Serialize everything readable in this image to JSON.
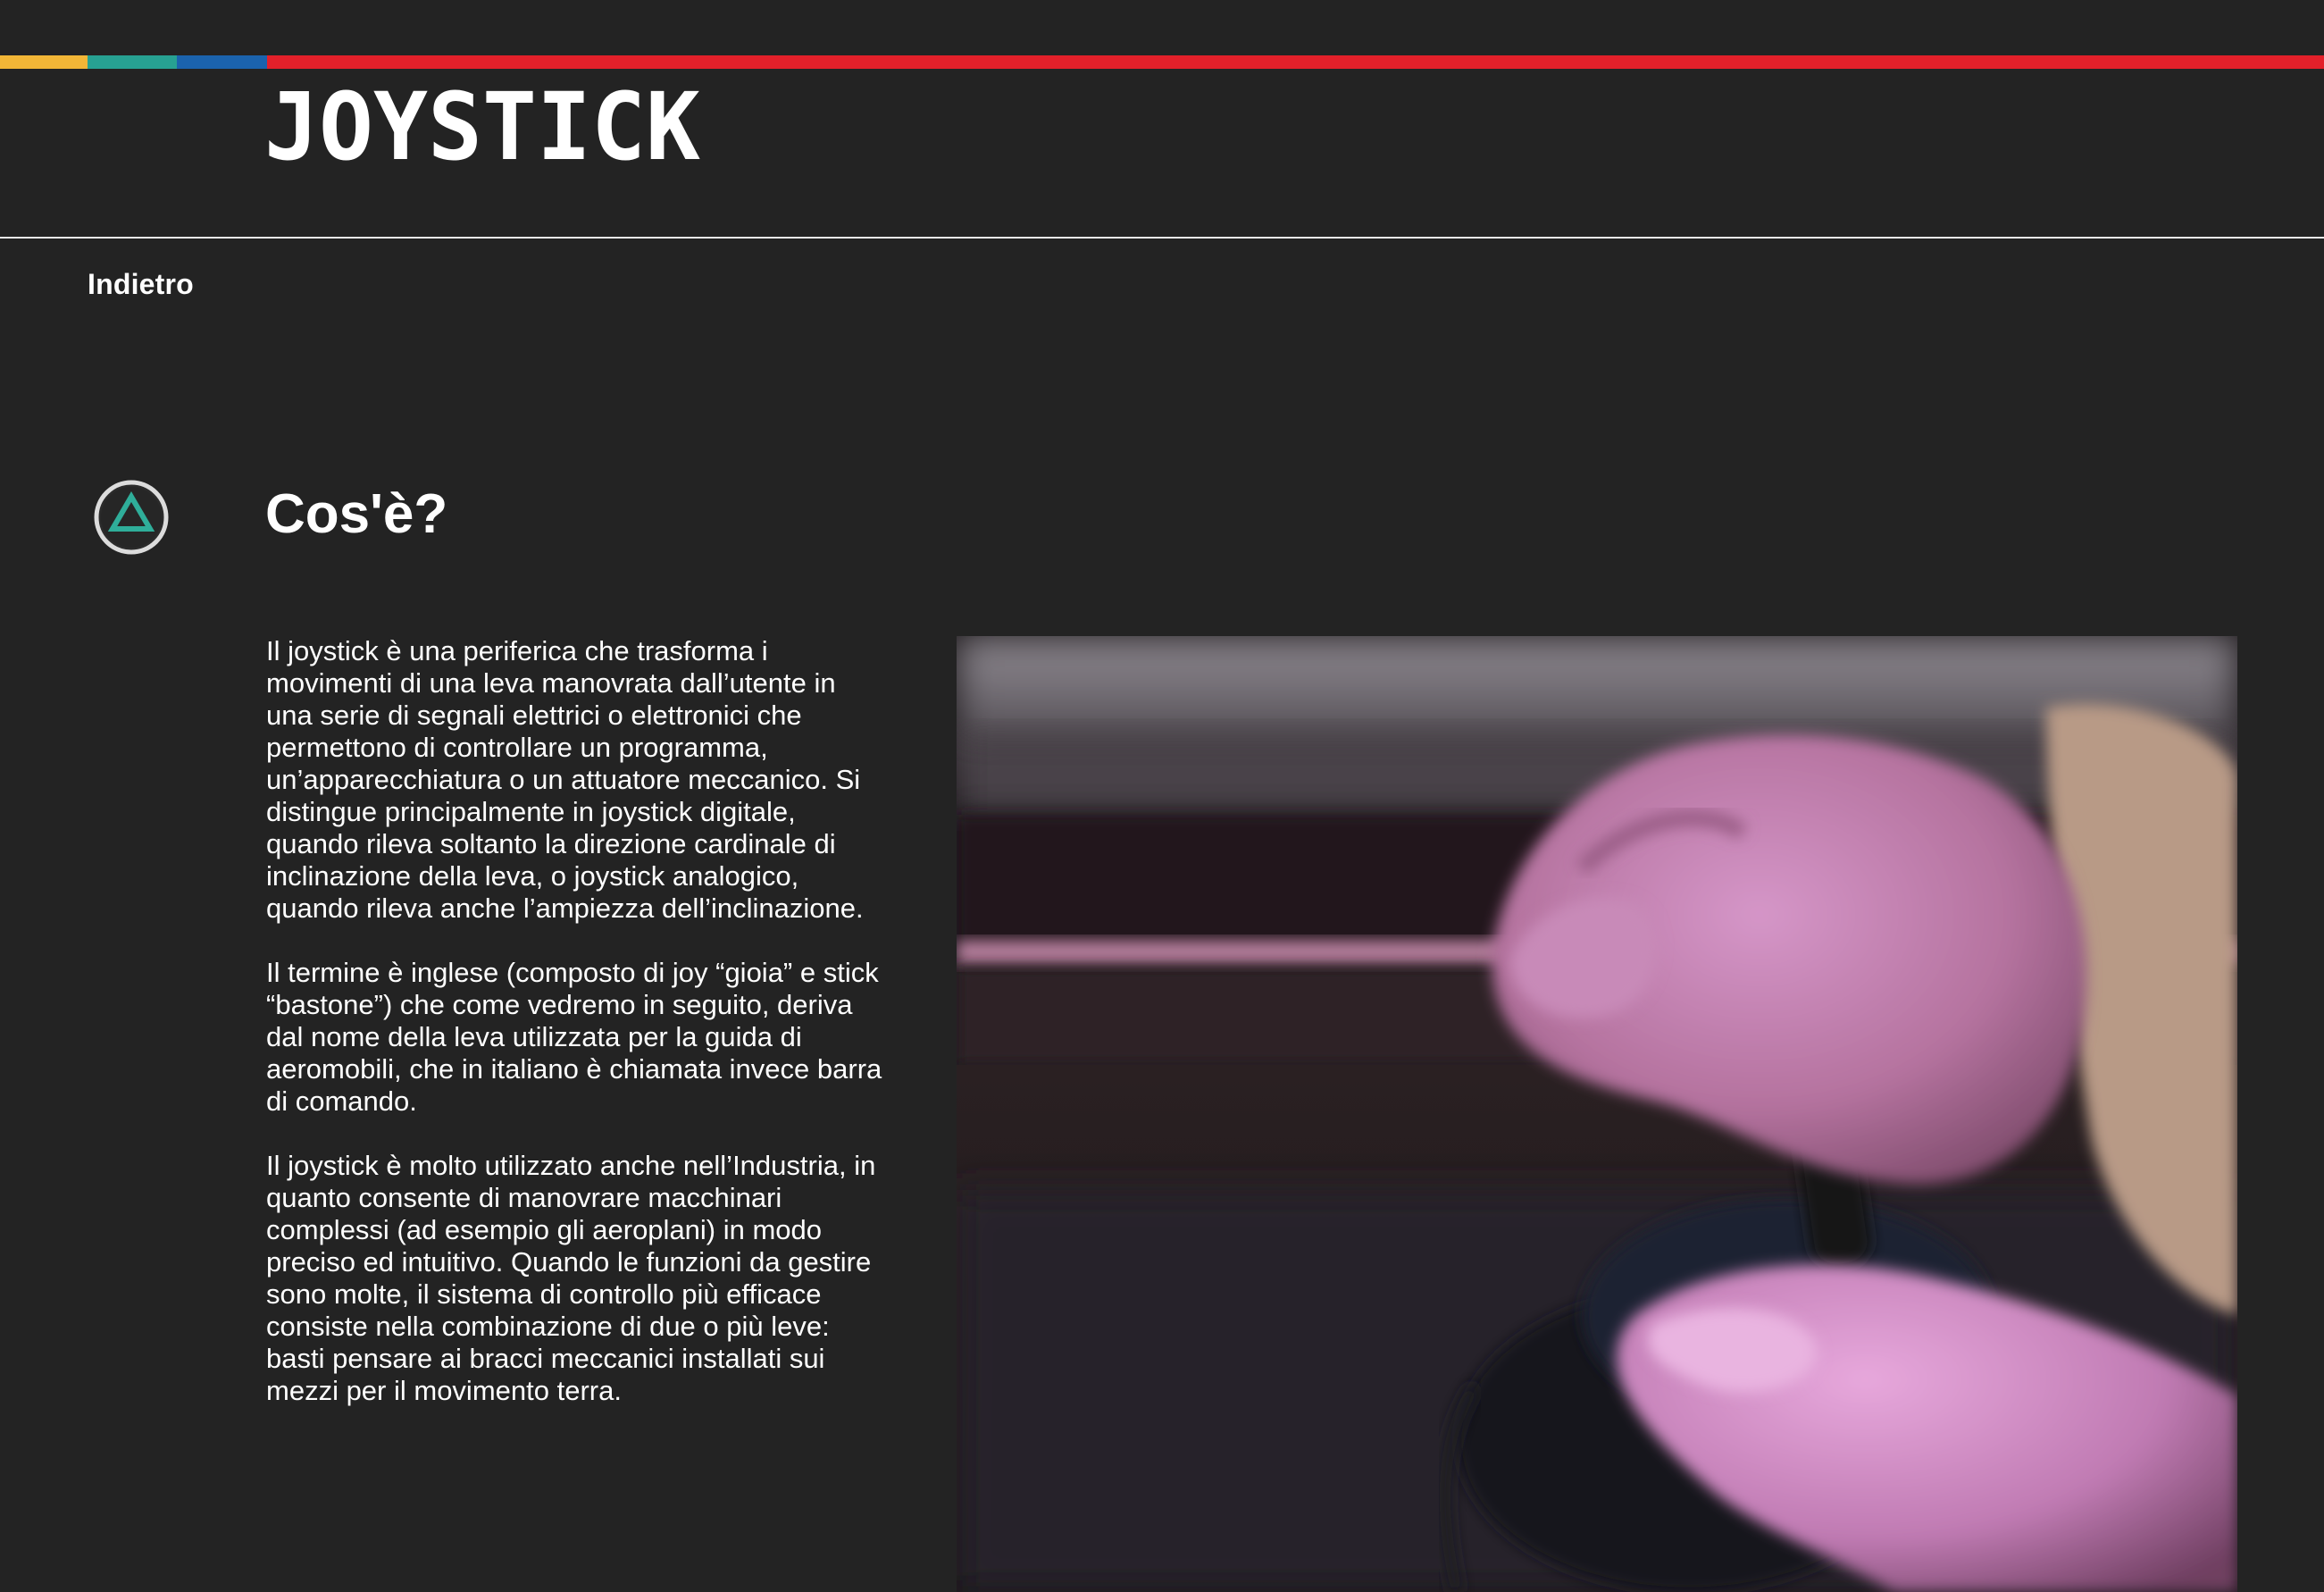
{
  "header": {
    "logo_text": "JOYSTICK",
    "stripe_colors": {
      "yellow": "#f2b637",
      "teal": "#27a192",
      "blue": "#1b63ad",
      "red": "#e3202a"
    }
  },
  "nav": {
    "back_label": "Indietro"
  },
  "section": {
    "icon": "playstation-triangle-icon",
    "icon_color": "#2fae9a",
    "title": "Cos'è?",
    "paragraphs": [
      "Il joystick è una periferica che trasforma i movimenti di una leva manovrata dall’utente in una serie di segnali elettrici o elettronici che permettono di controllare un programma, un’apparecchiatura o un attuatore meccanico. Si distingue principalmente in joystick digitale, quando rileva soltanto la direzione cardinale di inclinazione della leva, o joystick analogico, quando rileva anche l’ampiezza dell’inclinazione.",
      "Il termine è inglese (composto di joy “gioia” e stick “bastone”) che come vedremo in seguito, deriva dal nome della leva utilizzata per la guida di aeromobili, che in italiano è chiamata invece barra di comando.",
      "Il joystick è molto utilizzato anche nell’Industria, in quanto consente di manovrare macchinari complessi (ad esempio gli aeroplani) in modo preciso ed intuitivo. Quando le funzioni da gestire sono molte, il sistema di controllo più efficace consiste nella combinazione di due o più leve: basti pensare ai bracci meccanici installati sui mezzi per il movimento terra."
    ]
  },
  "media": {
    "image_subject": "hands-gripping-joystick"
  }
}
